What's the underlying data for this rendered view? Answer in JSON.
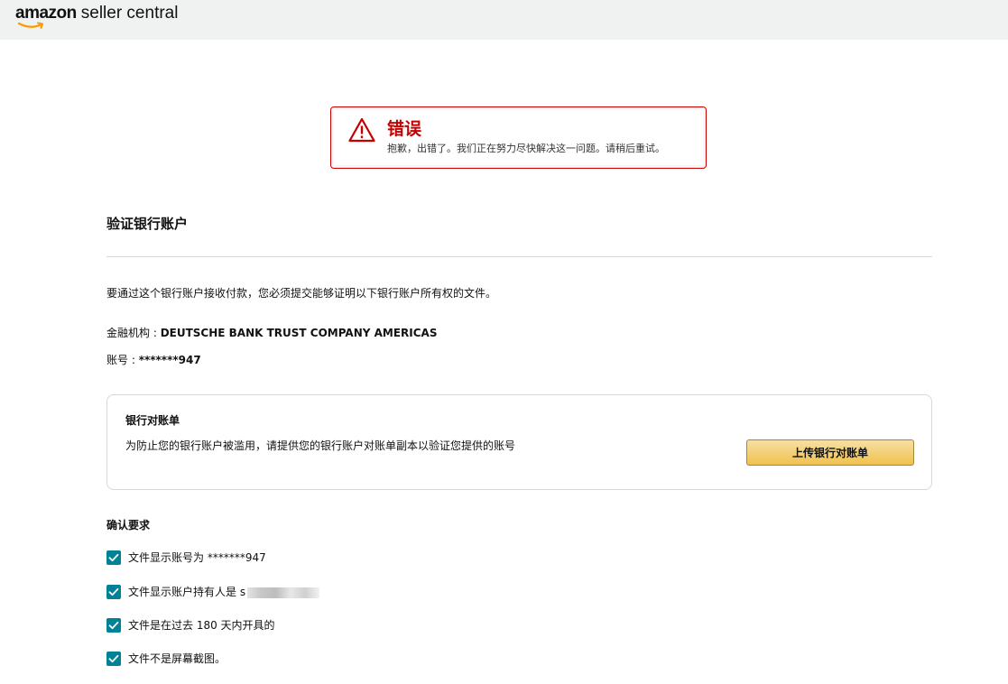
{
  "header": {
    "logo_brand": "amazon",
    "logo_product": "seller central"
  },
  "alert": {
    "title": "错误",
    "message": "抱歉，出错了。我们正在努力尽快解决这一问题。请稍后重试。",
    "icon": "warning-triangle-icon",
    "color": "#c40000"
  },
  "page": {
    "title": "验证银行账户",
    "intro": "要通过这个银行账户接收付款，您必须提交能够证明以下银行账户所有权的文件。"
  },
  "bank_info": {
    "institution_label": "金融机构 : ",
    "institution_value": "DEUTSCHE BANK TRUST COMPANY AMERICAS",
    "account_label": "账号 : ",
    "account_value": "*******947"
  },
  "statement_card": {
    "title": "银行对账单",
    "description": "为防止您的银行账户被滥用，请提供您的银行账户对账单副本以验证您提供的账号",
    "upload_button": "上传银行对账单"
  },
  "requirements": {
    "title": "确认要求",
    "items": [
      {
        "label": "文件显示账号为 *******947",
        "checked": true
      },
      {
        "label": "文件显示账户持有人是 s",
        "checked": true
      },
      {
        "label": "文件是在过去 180 天内开具的",
        "checked": true
      },
      {
        "label": "文件不是屏幕截图。",
        "checked": true
      }
    ]
  },
  "colors": {
    "accent_teal": "#008296",
    "button_gold": "#f0c14b",
    "error_red": "#c40000"
  }
}
